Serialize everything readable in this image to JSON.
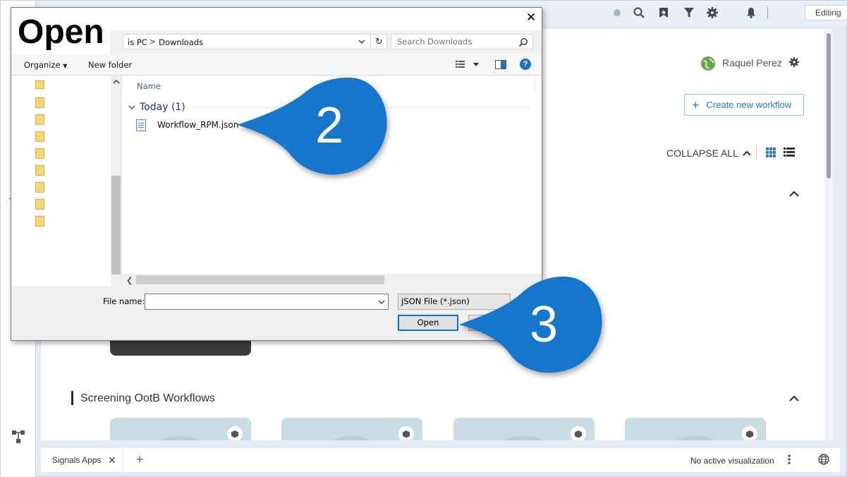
{
  "app": {
    "mode_label": "Editing",
    "user_name": "Raquel Perez",
    "create_button_label": "Create new workflow",
    "collapse_all_label": "COLLAPSE ALL",
    "section_title": "Screening OotB Workflows",
    "bottom_tab_label": "Signals Apps",
    "visualization_status": "No active visualization",
    "top_icons": [
      "extension-icon",
      "search-icon",
      "bookmark-icon",
      "filter-icon",
      "gear-icon",
      "bell-icon"
    ]
  },
  "dialog": {
    "title": "Open",
    "breadcrumb": {
      "pc": "is PC",
      "separator": ">",
      "folder": "Downloads"
    },
    "search_placeholder": "Search Downloads",
    "toolbar": {
      "organize_label": "Organize",
      "new_folder_label": "New folder"
    },
    "column_name": "Name",
    "group_label": "Today (1)",
    "files": [
      {
        "name": "Workflow_RPM.json"
      }
    ],
    "file_name_label": "File name:",
    "file_name_value": "",
    "file_type": "JSON File (*.json)",
    "open_button_label": "Open",
    "close_symbol": "✕"
  },
  "callouts": [
    {
      "label": "2"
    },
    {
      "label": "3"
    }
  ],
  "colors": {
    "callout": "#1476cc",
    "accent": "#2a7cbf",
    "dialog_focus": "#0078d7"
  }
}
